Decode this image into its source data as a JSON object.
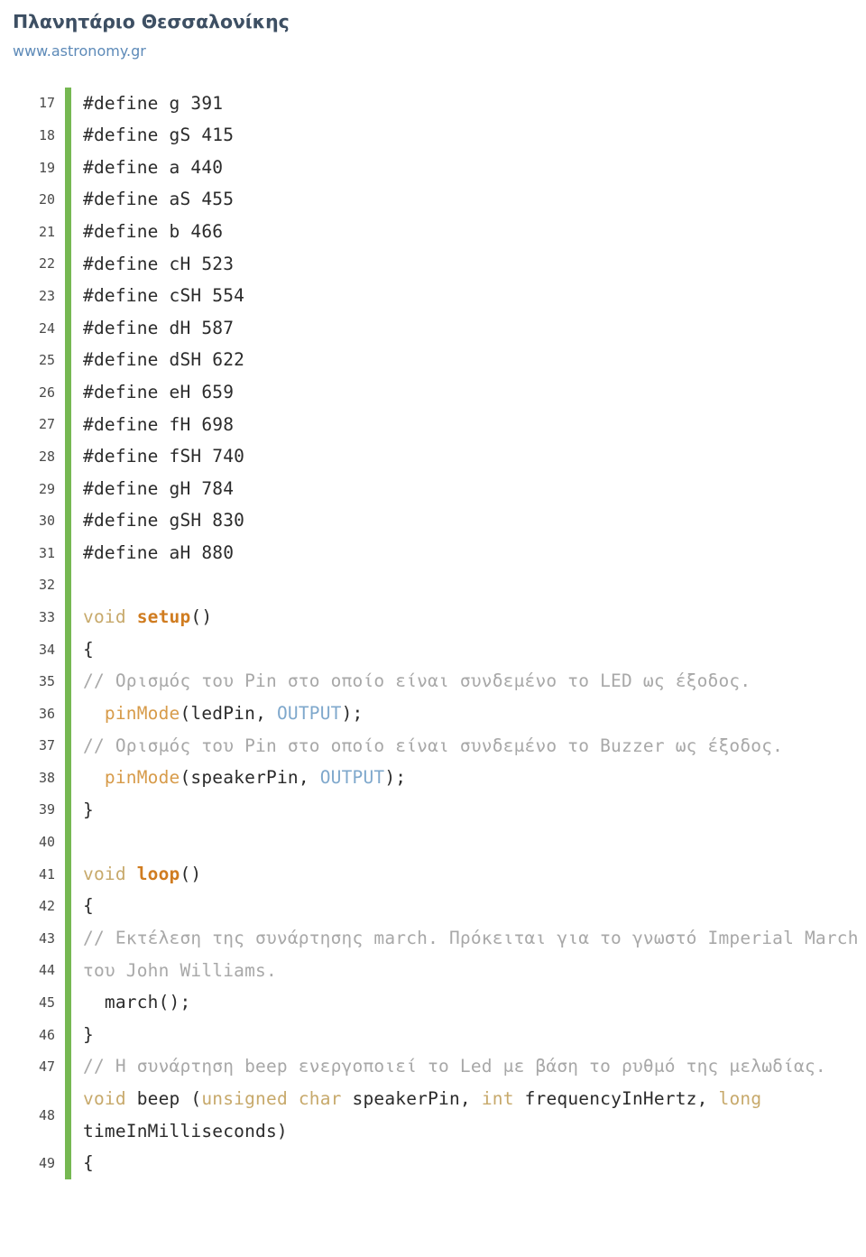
{
  "header": {
    "title": "Πλανητάριο Θεσσαλονίκης",
    "link": "www.astronomy.gr"
  },
  "colors": {
    "title": "#3d4f63",
    "link": "#5d8ab8",
    "rule": "#76b852",
    "keyword_type": "#c7a96b",
    "function_name": "#d07c20",
    "function_call": "#d79b4a",
    "constant": "#7fa8cc",
    "comment": "#a8a8a8",
    "plain": "#2b2b2b",
    "background": "#ffffff"
  },
  "code": {
    "language": "arduino-c",
    "first_line": 17,
    "last_line": 49,
    "lines": [
      {
        "n": "17",
        "tokens": [
          {
            "t": "#define g 391",
            "c": "plain"
          }
        ]
      },
      {
        "n": "18",
        "tokens": [
          {
            "t": "#define gS 415",
            "c": "plain"
          }
        ]
      },
      {
        "n": "19",
        "tokens": [
          {
            "t": "#define a 440",
            "c": "plain"
          }
        ]
      },
      {
        "n": "20",
        "tokens": [
          {
            "t": "#define aS 455",
            "c": "plain"
          }
        ]
      },
      {
        "n": "21",
        "tokens": [
          {
            "t": "#define b 466",
            "c": "plain"
          }
        ]
      },
      {
        "n": "22",
        "tokens": [
          {
            "t": "#define cH 523",
            "c": "plain"
          }
        ]
      },
      {
        "n": "23",
        "tokens": [
          {
            "t": "#define cSH 554",
            "c": "plain"
          }
        ]
      },
      {
        "n": "24",
        "tokens": [
          {
            "t": "#define dH 587",
            "c": "plain"
          }
        ]
      },
      {
        "n": "25",
        "tokens": [
          {
            "t": "#define dSH 622",
            "c": "plain"
          }
        ]
      },
      {
        "n": "26",
        "tokens": [
          {
            "t": "#define eH 659",
            "c": "plain"
          }
        ]
      },
      {
        "n": "27",
        "tokens": [
          {
            "t": "#define fH 698",
            "c": "plain"
          }
        ]
      },
      {
        "n": "28",
        "tokens": [
          {
            "t": "#define fSH 740",
            "c": "plain"
          }
        ]
      },
      {
        "n": "29",
        "tokens": [
          {
            "t": "#define gH 784",
            "c": "plain"
          }
        ]
      },
      {
        "n": "30",
        "tokens": [
          {
            "t": "#define gSH 830",
            "c": "plain"
          }
        ]
      },
      {
        "n": "31",
        "tokens": [
          {
            "t": "#define aH 880",
            "c": "plain"
          }
        ]
      },
      {
        "n": "32",
        "tokens": [
          {
            "t": "",
            "c": "plain"
          }
        ]
      },
      {
        "n": "33",
        "tokens": [
          {
            "t": "void ",
            "c": "type"
          },
          {
            "t": "setup",
            "c": "fn"
          },
          {
            "t": "()",
            "c": "punct"
          }
        ]
      },
      {
        "n": "34",
        "tokens": [
          {
            "t": "{",
            "c": "plain"
          }
        ]
      },
      {
        "n": "35",
        "tokens": [
          {
            "t": "// Ορισμός του Pin στο οποίο είναι συνδεμένο το LED ως έξοδος.",
            "c": "comment"
          }
        ]
      },
      {
        "n": "36",
        "tokens": [
          {
            "t": "  ",
            "c": "plain"
          },
          {
            "t": "pinMode",
            "c": "call"
          },
          {
            "t": "(ledPin, ",
            "c": "punct"
          },
          {
            "t": "OUTPUT",
            "c": "const"
          },
          {
            "t": ");",
            "c": "punct"
          }
        ]
      },
      {
        "n": "37",
        "tokens": [
          {
            "t": "// Ορισμός του Pin στο οποίο είναι συνδεμένο το Buzzer ως έξοδος.",
            "c": "comment"
          }
        ]
      },
      {
        "n": "38",
        "tokens": [
          {
            "t": "  ",
            "c": "plain"
          },
          {
            "t": "pinMode",
            "c": "call"
          },
          {
            "t": "(speakerPin, ",
            "c": "punct"
          },
          {
            "t": "OUTPUT",
            "c": "const"
          },
          {
            "t": ");",
            "c": "punct"
          }
        ]
      },
      {
        "n": "39",
        "tokens": [
          {
            "t": "}",
            "c": "plain"
          }
        ]
      },
      {
        "n": "40",
        "tokens": [
          {
            "t": "",
            "c": "plain"
          }
        ]
      },
      {
        "n": "41",
        "tokens": [
          {
            "t": "void ",
            "c": "type"
          },
          {
            "t": "loop",
            "c": "fn"
          },
          {
            "t": "()",
            "c": "punct"
          }
        ]
      },
      {
        "n": "42",
        "tokens": [
          {
            "t": "{",
            "c": "plain"
          }
        ]
      },
      {
        "n": "43",
        "tokens": [
          {
            "t": "// Εκτέλεση της συνάρτησης march. Πρόκειται για το γνωστό Imperial March",
            "c": "comment"
          }
        ]
      },
      {
        "n": "44",
        "tokens": [
          {
            "t": "του John Williams.",
            "c": "comment"
          }
        ]
      },
      {
        "n": "45",
        "tokens": [
          {
            "t": "  march();",
            "c": "plain"
          }
        ]
      },
      {
        "n": "46",
        "tokens": [
          {
            "t": "}",
            "c": "plain"
          }
        ]
      },
      {
        "n": "47",
        "tokens": [
          {
            "t": "// Η συνάρτηση beep ενεργοποιεί το Led με βάση το ρυθμό της μελωδίας.",
            "c": "comment"
          }
        ]
      },
      {
        "n": "48",
        "tokens": [
          {
            "t": "void ",
            "c": "type"
          },
          {
            "t": "beep ",
            "c": "plain"
          },
          {
            "t": "(",
            "c": "punct"
          },
          {
            "t": "unsigned char ",
            "c": "type"
          },
          {
            "t": "speakerPin, ",
            "c": "plain"
          },
          {
            "t": "int ",
            "c": "type"
          },
          {
            "t": "frequencyInHertz, ",
            "c": "plain"
          },
          {
            "t": "long ",
            "c": "type"
          },
          {
            "t": "timeInMilliseconds)",
            "c": "plain"
          }
        ]
      },
      {
        "n": "49",
        "tokens": [
          {
            "t": "{",
            "c": "plain"
          }
        ]
      }
    ]
  }
}
